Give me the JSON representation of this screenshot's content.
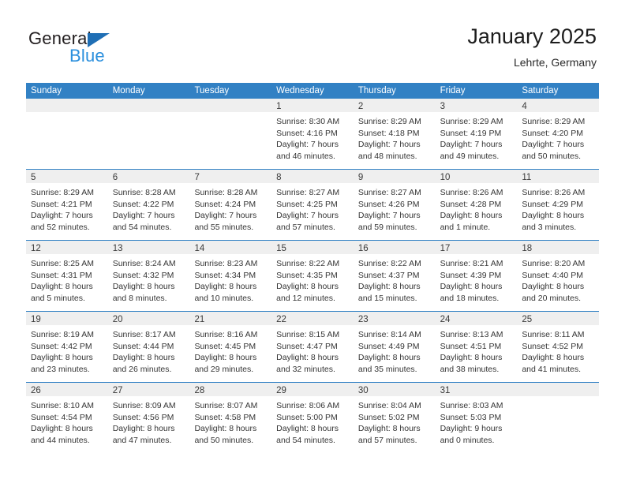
{
  "brand": {
    "word1": "General",
    "word2": "Blue",
    "triangle_color": "#1f6fb5",
    "word2_color": "#2a8fdd"
  },
  "header": {
    "title": "January 2025",
    "location": "Lehrte, Germany",
    "accent_color": "#3281c4"
  },
  "labels": {
    "sunrise_prefix": "Sunrise:",
    "sunset_prefix": "Sunset:",
    "daylight_prefix": "Daylight:"
  },
  "weekdays": [
    "Sunday",
    "Monday",
    "Tuesday",
    "Wednesday",
    "Thursday",
    "Friday",
    "Saturday"
  ],
  "weeks": [
    [
      {
        "day": ""
      },
      {
        "day": ""
      },
      {
        "day": ""
      },
      {
        "day": "1",
        "sunrise": "Sunrise: 8:30 AM",
        "sunset": "Sunset: 4:16 PM",
        "daylight1": "Daylight: 7 hours",
        "daylight2": "and 46 minutes."
      },
      {
        "day": "2",
        "sunrise": "Sunrise: 8:29 AM",
        "sunset": "Sunset: 4:18 PM",
        "daylight1": "Daylight: 7 hours",
        "daylight2": "and 48 minutes."
      },
      {
        "day": "3",
        "sunrise": "Sunrise: 8:29 AM",
        "sunset": "Sunset: 4:19 PM",
        "daylight1": "Daylight: 7 hours",
        "daylight2": "and 49 minutes."
      },
      {
        "day": "4",
        "sunrise": "Sunrise: 8:29 AM",
        "sunset": "Sunset: 4:20 PM",
        "daylight1": "Daylight: 7 hours",
        "daylight2": "and 50 minutes."
      }
    ],
    [
      {
        "day": "5",
        "sunrise": "Sunrise: 8:29 AM",
        "sunset": "Sunset: 4:21 PM",
        "daylight1": "Daylight: 7 hours",
        "daylight2": "and 52 minutes."
      },
      {
        "day": "6",
        "sunrise": "Sunrise: 8:28 AM",
        "sunset": "Sunset: 4:22 PM",
        "daylight1": "Daylight: 7 hours",
        "daylight2": "and 54 minutes."
      },
      {
        "day": "7",
        "sunrise": "Sunrise: 8:28 AM",
        "sunset": "Sunset: 4:24 PM",
        "daylight1": "Daylight: 7 hours",
        "daylight2": "and 55 minutes."
      },
      {
        "day": "8",
        "sunrise": "Sunrise: 8:27 AM",
        "sunset": "Sunset: 4:25 PM",
        "daylight1": "Daylight: 7 hours",
        "daylight2": "and 57 minutes."
      },
      {
        "day": "9",
        "sunrise": "Sunrise: 8:27 AM",
        "sunset": "Sunset: 4:26 PM",
        "daylight1": "Daylight: 7 hours",
        "daylight2": "and 59 minutes."
      },
      {
        "day": "10",
        "sunrise": "Sunrise: 8:26 AM",
        "sunset": "Sunset: 4:28 PM",
        "daylight1": "Daylight: 8 hours",
        "daylight2": "and 1 minute."
      },
      {
        "day": "11",
        "sunrise": "Sunrise: 8:26 AM",
        "sunset": "Sunset: 4:29 PM",
        "daylight1": "Daylight: 8 hours",
        "daylight2": "and 3 minutes."
      }
    ],
    [
      {
        "day": "12",
        "sunrise": "Sunrise: 8:25 AM",
        "sunset": "Sunset: 4:31 PM",
        "daylight1": "Daylight: 8 hours",
        "daylight2": "and 5 minutes."
      },
      {
        "day": "13",
        "sunrise": "Sunrise: 8:24 AM",
        "sunset": "Sunset: 4:32 PM",
        "daylight1": "Daylight: 8 hours",
        "daylight2": "and 8 minutes."
      },
      {
        "day": "14",
        "sunrise": "Sunrise: 8:23 AM",
        "sunset": "Sunset: 4:34 PM",
        "daylight1": "Daylight: 8 hours",
        "daylight2": "and 10 minutes."
      },
      {
        "day": "15",
        "sunrise": "Sunrise: 8:22 AM",
        "sunset": "Sunset: 4:35 PM",
        "daylight1": "Daylight: 8 hours",
        "daylight2": "and 12 minutes."
      },
      {
        "day": "16",
        "sunrise": "Sunrise: 8:22 AM",
        "sunset": "Sunset: 4:37 PM",
        "daylight1": "Daylight: 8 hours",
        "daylight2": "and 15 minutes."
      },
      {
        "day": "17",
        "sunrise": "Sunrise: 8:21 AM",
        "sunset": "Sunset: 4:39 PM",
        "daylight1": "Daylight: 8 hours",
        "daylight2": "and 18 minutes."
      },
      {
        "day": "18",
        "sunrise": "Sunrise: 8:20 AM",
        "sunset": "Sunset: 4:40 PM",
        "daylight1": "Daylight: 8 hours",
        "daylight2": "and 20 minutes."
      }
    ],
    [
      {
        "day": "19",
        "sunrise": "Sunrise: 8:19 AM",
        "sunset": "Sunset: 4:42 PM",
        "daylight1": "Daylight: 8 hours",
        "daylight2": "and 23 minutes."
      },
      {
        "day": "20",
        "sunrise": "Sunrise: 8:17 AM",
        "sunset": "Sunset: 4:44 PM",
        "daylight1": "Daylight: 8 hours",
        "daylight2": "and 26 minutes."
      },
      {
        "day": "21",
        "sunrise": "Sunrise: 8:16 AM",
        "sunset": "Sunset: 4:45 PM",
        "daylight1": "Daylight: 8 hours",
        "daylight2": "and 29 minutes."
      },
      {
        "day": "22",
        "sunrise": "Sunrise: 8:15 AM",
        "sunset": "Sunset: 4:47 PM",
        "daylight1": "Daylight: 8 hours",
        "daylight2": "and 32 minutes."
      },
      {
        "day": "23",
        "sunrise": "Sunrise: 8:14 AM",
        "sunset": "Sunset: 4:49 PM",
        "daylight1": "Daylight: 8 hours",
        "daylight2": "and 35 minutes."
      },
      {
        "day": "24",
        "sunrise": "Sunrise: 8:13 AM",
        "sunset": "Sunset: 4:51 PM",
        "daylight1": "Daylight: 8 hours",
        "daylight2": "and 38 minutes."
      },
      {
        "day": "25",
        "sunrise": "Sunrise: 8:11 AM",
        "sunset": "Sunset: 4:52 PM",
        "daylight1": "Daylight: 8 hours",
        "daylight2": "and 41 minutes."
      }
    ],
    [
      {
        "day": "26",
        "sunrise": "Sunrise: 8:10 AM",
        "sunset": "Sunset: 4:54 PM",
        "daylight1": "Daylight: 8 hours",
        "daylight2": "and 44 minutes."
      },
      {
        "day": "27",
        "sunrise": "Sunrise: 8:09 AM",
        "sunset": "Sunset: 4:56 PM",
        "daylight1": "Daylight: 8 hours",
        "daylight2": "and 47 minutes."
      },
      {
        "day": "28",
        "sunrise": "Sunrise: 8:07 AM",
        "sunset": "Sunset: 4:58 PM",
        "daylight1": "Daylight: 8 hours",
        "daylight2": "and 50 minutes."
      },
      {
        "day": "29",
        "sunrise": "Sunrise: 8:06 AM",
        "sunset": "Sunset: 5:00 PM",
        "daylight1": "Daylight: 8 hours",
        "daylight2": "and 54 minutes."
      },
      {
        "day": "30",
        "sunrise": "Sunrise: 8:04 AM",
        "sunset": "Sunset: 5:02 PM",
        "daylight1": "Daylight: 8 hours",
        "daylight2": "and 57 minutes."
      },
      {
        "day": "31",
        "sunrise": "Sunrise: 8:03 AM",
        "sunset": "Sunset: 5:03 PM",
        "daylight1": "Daylight: 9 hours",
        "daylight2": "and 0 minutes."
      },
      {
        "day": ""
      }
    ]
  ]
}
